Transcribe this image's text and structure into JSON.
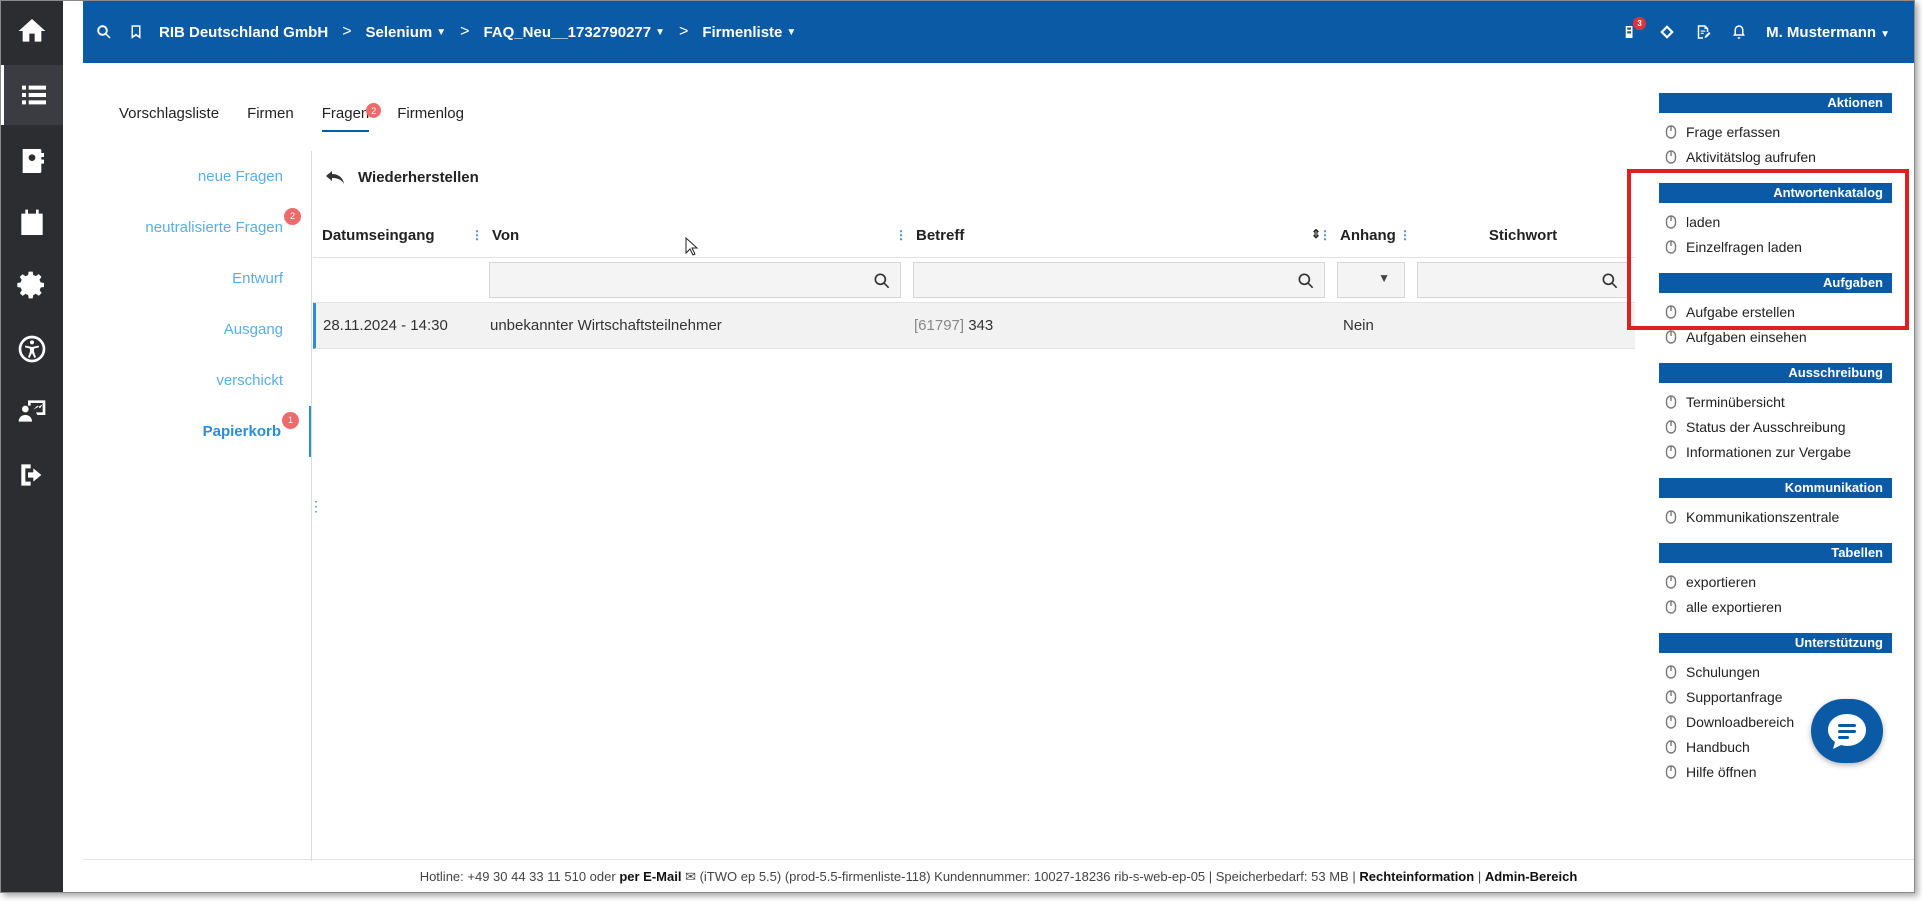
{
  "header": {
    "breadcrumbs": [
      {
        "label": "RIB Deutschland GmbH",
        "has_caret": false
      },
      {
        "label": "Selenium",
        "has_caret": true
      },
      {
        "label": "FAQ_Neu__1732790277",
        "has_caret": true
      },
      {
        "label": "Firmenliste",
        "has_caret": true
      }
    ],
    "notification_badge": "3",
    "user_name": "M. Mustermann"
  },
  "tabs": [
    {
      "label": "Vorschlagsliste",
      "badge": null,
      "active": false
    },
    {
      "label": "Firmen",
      "badge": null,
      "active": false
    },
    {
      "label": "Fragen",
      "badge": "2",
      "active": true
    },
    {
      "label": "Firmenlog",
      "badge": null,
      "active": false
    }
  ],
  "folders": [
    {
      "label": "neue Fragen",
      "badge": null,
      "active": false
    },
    {
      "label": "neutralisierte Fragen",
      "badge": "2",
      "active": false
    },
    {
      "label": "Entwurf",
      "badge": null,
      "active": false
    },
    {
      "label": "Ausgang",
      "badge": null,
      "active": false
    },
    {
      "label": "verschickt",
      "badge": null,
      "active": false
    },
    {
      "label": "Papierkorb",
      "badge": "1",
      "active": true
    }
  ],
  "toolbar": {
    "restore_label": "Wiederherstellen"
  },
  "table": {
    "columns": [
      "Datumseingang",
      "Von",
      "Betreff",
      "Anhang",
      "Stichwort"
    ],
    "rows": [
      {
        "datum": "28.11.2024 - 14:30",
        "von": "unbekannter Wirtschaftsteilnehmer",
        "ref": "[61797]",
        "betreff": "343",
        "anhang": "Nein",
        "stichwort": ""
      }
    ]
  },
  "actions_panel": {
    "sections": [
      {
        "title": "Aktionen",
        "items": [
          "Frage erfassen",
          "Aktivitätslog aufrufen"
        ]
      },
      {
        "title": "Antwortenkatalog",
        "items": [
          "laden",
          "Einzelfragen laden"
        ]
      },
      {
        "title": "Aufgaben",
        "items": [
          "Aufgabe erstellen",
          "Aufgaben einsehen"
        ]
      },
      {
        "title": "Ausschreibung",
        "items": [
          "Terminübersicht",
          "Status der Ausschreibung",
          "Informationen zur Vergabe"
        ]
      },
      {
        "title": "Kommunikation",
        "items": [
          "Kommunikationszentrale"
        ]
      },
      {
        "title": "Tabellen",
        "items": [
          "exportieren",
          "alle exportieren"
        ]
      },
      {
        "title": "Unterstützung",
        "items": [
          "Schulungen",
          "Supportanfrage",
          "Downloadbereich",
          "Handbuch",
          "Hilfe öffnen"
        ]
      }
    ]
  },
  "footer": {
    "hotline": "Hotline: +49 30 44 33 11 510 oder",
    "email_link": "per E-Mail",
    "version": "(iTWO ep 5.5) (prod-5.5-firmenliste-118)",
    "customer": "Kundennummer: 10027-18236 rib-s-web-ep-05 | Speicherbedarf: 53 MB |",
    "legal_link": "Rechteinformation",
    "separator": "|",
    "admin_link": "Admin-Bereich"
  },
  "colors": {
    "primary": "#0b5aa5",
    "sidebar": "#2b2d31",
    "badge": "#ef6b6b",
    "highlight": "#e02020",
    "folder_link": "#5aaee4"
  }
}
